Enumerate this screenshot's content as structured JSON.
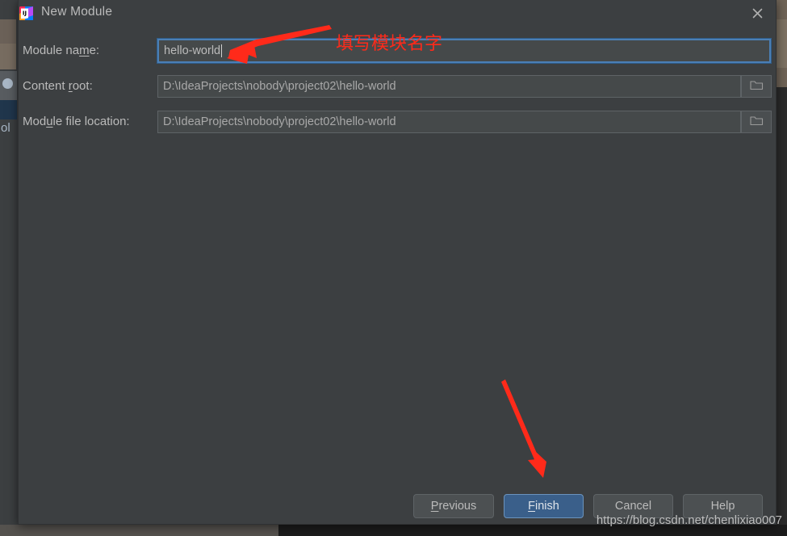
{
  "window": {
    "title": "New Module",
    "logo_icon": "intellij-idea-logo",
    "close_icon": "close-icon"
  },
  "form": {
    "fields": [
      {
        "label_pre": "Module na",
        "label_mnemonic": "m",
        "label_post": "e:",
        "value": "hello-world",
        "focused": true,
        "has_browse": false,
        "browse_icon": ""
      },
      {
        "label_pre": "Content ",
        "label_mnemonic": "r",
        "label_post": "oot:",
        "value": "D:\\IdeaProjects\\nobody\\project02\\hello-world",
        "focused": false,
        "has_browse": true,
        "browse_icon": "folder-icon"
      },
      {
        "label_pre": "Mod",
        "label_mnemonic": "u",
        "label_post": "le file location:",
        "value": "D:\\IdeaProjects\\nobody\\project02\\hello-world",
        "focused": false,
        "has_browse": true,
        "browse_icon": "folder-icon"
      }
    ]
  },
  "buttons": {
    "previous": {
      "pre": "",
      "mnemonic": "P",
      "post": "revious",
      "primary": false
    },
    "finish": {
      "pre": "",
      "mnemonic": "F",
      "post": "inish",
      "primary": true
    },
    "cancel": {
      "pre": "Cancel",
      "mnemonic": "",
      "post": "",
      "primary": false
    },
    "help": {
      "pre": "Help",
      "mnemonic": "",
      "post": "",
      "primary": false
    }
  },
  "annotations": {
    "module_name_note": "填写模块名字",
    "arrow_color": "#ff2a1a"
  },
  "watermark": {
    "text": "https://blog.csdn.net/chenlixiao007"
  },
  "background": {
    "text_fragment": "ol"
  },
  "colors": {
    "dialog_bg": "#3c3f41",
    "field_bg": "#45494a",
    "focus_border": "#4b7fb5",
    "primary_button": "#3a5f8a",
    "text": "#bbbbbb",
    "annotation_red": "#ff2a1a"
  }
}
